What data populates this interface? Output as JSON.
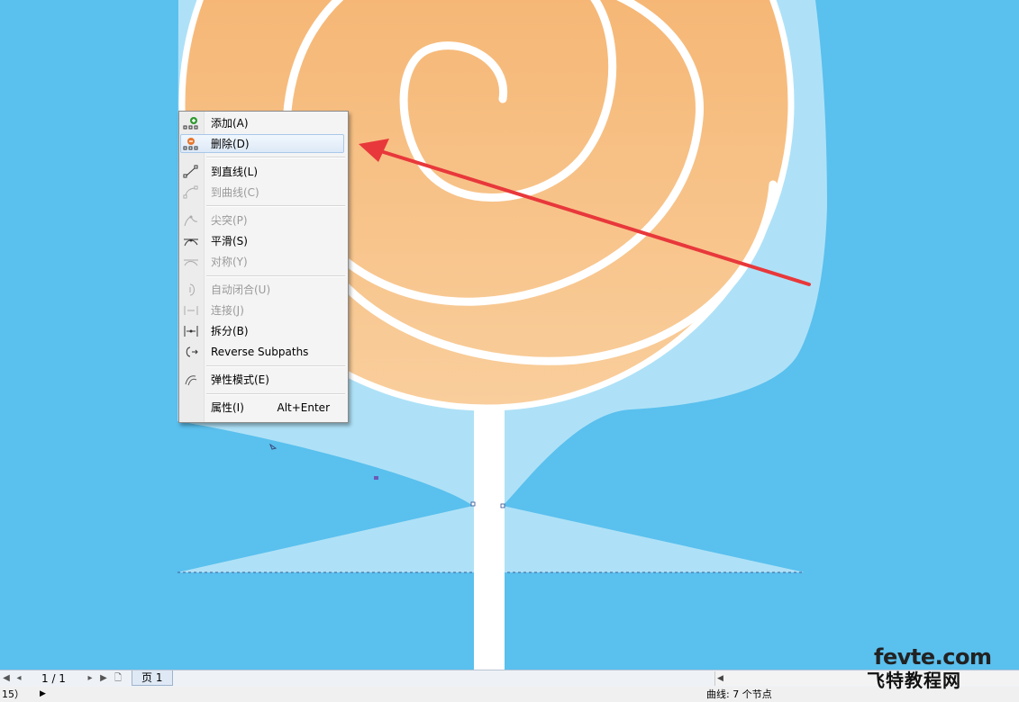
{
  "menu": {
    "items": [
      {
        "label": "添加(A)",
        "icon": "add-node-icon",
        "enabled": true
      },
      {
        "label": "删除(D)",
        "icon": "delete-node-icon",
        "enabled": true,
        "highlighted": true
      },
      {
        "label": "到直线(L)",
        "icon": "to-line-icon",
        "enabled": true
      },
      {
        "label": "到曲线(C)",
        "icon": "to-curve-icon",
        "enabled": false
      },
      {
        "label": "尖突(P)",
        "icon": "cusp-icon",
        "enabled": false
      },
      {
        "label": "平滑(S)",
        "icon": "smooth-icon",
        "enabled": true
      },
      {
        "label": "对称(Y)",
        "icon": "symmetric-icon",
        "enabled": false
      },
      {
        "label": "自动闭合(U)",
        "icon": "auto-close-icon",
        "enabled": false
      },
      {
        "label": "连接(J)",
        "icon": "join-icon",
        "enabled": false
      },
      {
        "label": "拆分(B)",
        "icon": "break-icon",
        "enabled": true
      },
      {
        "label": "Reverse Subpaths",
        "icon": "reverse-subpaths-icon",
        "enabled": true
      },
      {
        "label": "弹性模式(E)",
        "icon": "elastic-mode-icon",
        "enabled": true
      },
      {
        "label": "属性(I)",
        "shortcut": "Alt+Enter",
        "enabled": true
      }
    ]
  },
  "pagebar": {
    "page_counter": "1 / 1",
    "page_tab": "页 1"
  },
  "statusbar": {
    "left": "15）",
    "right": "曲线: 7 个节点"
  },
  "watermark": {
    "top": "fevte.com",
    "bottom": "飞特教程网"
  },
  "colors": {
    "canvas_bg": "#5ac0ee",
    "glass": "#b3e3f7",
    "candy_orange": "#f5b069",
    "arrow_red": "#e8383b"
  }
}
